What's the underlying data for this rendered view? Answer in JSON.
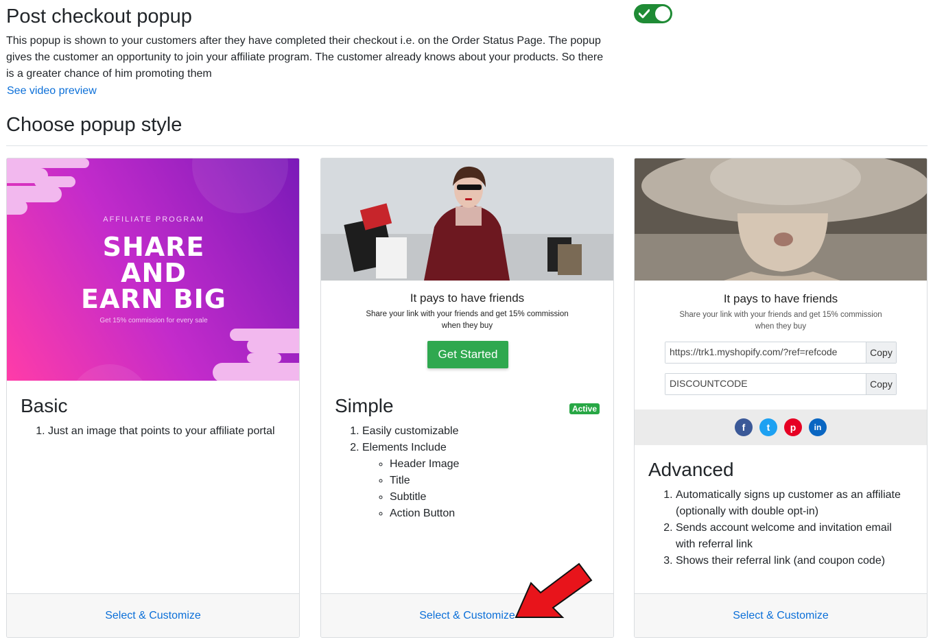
{
  "header": {
    "title": "Post checkout popup",
    "description": "This popup is shown to your customers after they have completed their checkout i.e. on the Order Status Page. The popup gives the customer an opportunity to join your affiliate program. The customer already knows about your products. So there is a greater chance of him promoting them",
    "video_link": "See video preview",
    "toggle_on": true
  },
  "section": {
    "title": "Choose popup style"
  },
  "cards": [
    {
      "title": "Basic",
      "preview": {
        "eyebrow": "AFFILIATE PROGRAM",
        "headline_1": "SHARE",
        "headline_2": "AND",
        "headline_3": "EARN BIG",
        "subtext": "Get 15% commission for every sale"
      },
      "features": [
        "Just an image that points to your affiliate portal"
      ],
      "footer": "Select & Customize"
    },
    {
      "title": "Simple",
      "badge": "Active",
      "preview": {
        "title": "It pays to have friends",
        "subtitle_1": "Share your link with your friends and get 15% commission",
        "subtitle_2": "when they buy",
        "button": "Get Started"
      },
      "features": [
        "Easily customizable",
        "Elements Include"
      ],
      "sub_features": [
        "Header Image",
        "Title",
        "Subtitle",
        "Action Button"
      ],
      "footer": "Select & Customize"
    },
    {
      "title": "Advanced",
      "preview": {
        "title": "It pays to have friends",
        "subtitle_1": "Share your link with your friends and get 15% commission",
        "subtitle_2": "when they buy",
        "link_value": "https://trk1.myshopify.com/?ref=refcode",
        "code_value": "DISCOUNTCODE",
        "copy_label": "Copy",
        "social": [
          "f",
          "t",
          "p",
          "in"
        ]
      },
      "features": [
        "Automatically signs up customer as an affiliate (optionally with double opt-in)",
        "Sends account welcome and invitation email with referral link",
        "Shows their referral link (and coupon code)"
      ],
      "footer": "Select & Customize"
    }
  ],
  "colors": {
    "link": "#0b6fd8",
    "toggle": "#1f8b35",
    "cta": "#2fa84f",
    "badge": "#28a745",
    "arrow": "#e8141b"
  }
}
